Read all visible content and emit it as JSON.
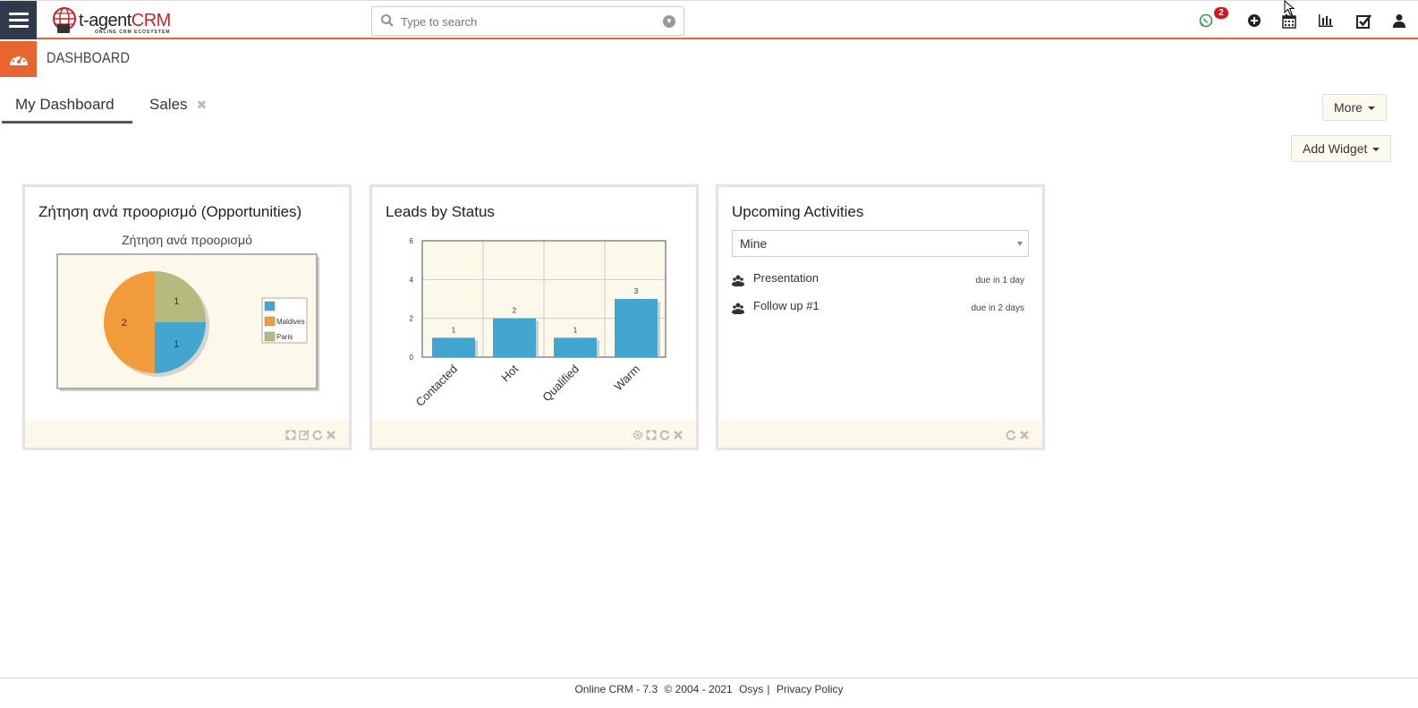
{
  "header": {
    "logo_text_main": "t-agent",
    "logo_text_accent": "CRM",
    "logo_subtitle": "ONLINE CRM ECOSYSTEM",
    "search_placeholder": "Type to search",
    "notification_count": "2",
    "icons": [
      "whatsapp-icon",
      "plus-circle-icon",
      "calendar-icon",
      "bar-chart-icon",
      "checkbox-icon",
      "user-icon"
    ]
  },
  "subheader": {
    "title": "DASHBOARD"
  },
  "tabs": [
    {
      "label": "My Dashboard",
      "active": true
    },
    {
      "label": "Sales",
      "active": false,
      "closable": true
    }
  ],
  "buttons": {
    "more": "More",
    "add_widget": "Add Widget"
  },
  "widgets": {
    "pie": {
      "title": "Ζήτηση ανά προορισμό (Opportunities)",
      "subtitle": "Ζήτηση ανά προορισμό"
    },
    "bar": {
      "title": "Leads by Status"
    },
    "activities": {
      "title": "Upcoming Activities",
      "filter_value": "Mine",
      "items": [
        {
          "name": "Presentation",
          "due": "due in 1 day"
        },
        {
          "name": "Follow up #1",
          "due": "due in 2 days"
        }
      ]
    }
  },
  "chart_data": [
    {
      "type": "pie",
      "slices": [
        {
          "label": "",
          "value": 1,
          "color": "#42a6d1"
        },
        {
          "label": "Maldives",
          "value": 2,
          "color": "#f19b3a"
        },
        {
          "label": "Paris",
          "value": 1,
          "color": "#b5bb7e"
        }
      ],
      "legend_position": "right"
    },
    {
      "type": "bar",
      "categories": [
        "Contacted",
        "Hot",
        "Qualified",
        "Warm"
      ],
      "values": [
        1,
        2,
        1,
        3
      ],
      "ylim": [
        0,
        6
      ],
      "yticks": [
        0,
        2,
        4,
        6
      ],
      "color": "#42a6d1",
      "grid": true
    }
  ],
  "footer": {
    "version": "Online CRM - 7.3",
    "copyright": "© 2004 - 2021",
    "company": "Osys",
    "separator": "|",
    "privacy": "Privacy Policy"
  },
  "colors": {
    "accent": "#e8652f",
    "nav_dark": "#2f3b4c",
    "widget_border": "#eadfe9",
    "widget_footer": "#fdf9ea",
    "chart_bg": "#fdf9ea"
  }
}
